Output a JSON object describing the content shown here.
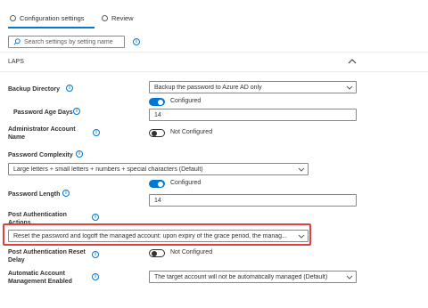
{
  "tabs": [
    {
      "label": "Configuration settings",
      "selected": true
    },
    {
      "label": "Review",
      "selected": false
    }
  ],
  "search": {
    "placeholder": "Search settings by setting name"
  },
  "section": {
    "title": "LAPS"
  },
  "settings": {
    "backup_directory": {
      "label": "Backup Directory",
      "value": "Backup the password to Azure AD only"
    },
    "password_age_days": {
      "label": "Password Age Days",
      "toggle_text": "Configured",
      "value": "14"
    },
    "admin_account_name": {
      "label": "Administrator Account Name",
      "toggle_text": "Not Configured"
    },
    "password_complexity": {
      "label": "Password Complexity",
      "value": "Large letters + small letters + numbers + special characters (Default)"
    },
    "password_length": {
      "label": "Password Length",
      "toggle_text": "Configured",
      "value": "14"
    },
    "post_auth_actions": {
      "label": "Post Authentication Actions",
      "value": "Reset the password and logoff the managed account: upon expiry of the grace period, the manag..."
    },
    "post_auth_reset_delay": {
      "label": "Post Authentication Reset Delay",
      "toggle_text": "Not Configured"
    },
    "auto_account_mgmt": {
      "label": "Automatic Account Management Enabled",
      "value": "The target account will not be automatically managed (Default)"
    }
  },
  "colors": {
    "accent": "#0078d4",
    "highlight": "#e04040"
  },
  "icons": [
    "radio-icon",
    "search-icon",
    "info-icon",
    "chevron-up-icon",
    "chevron-down-icon"
  ]
}
